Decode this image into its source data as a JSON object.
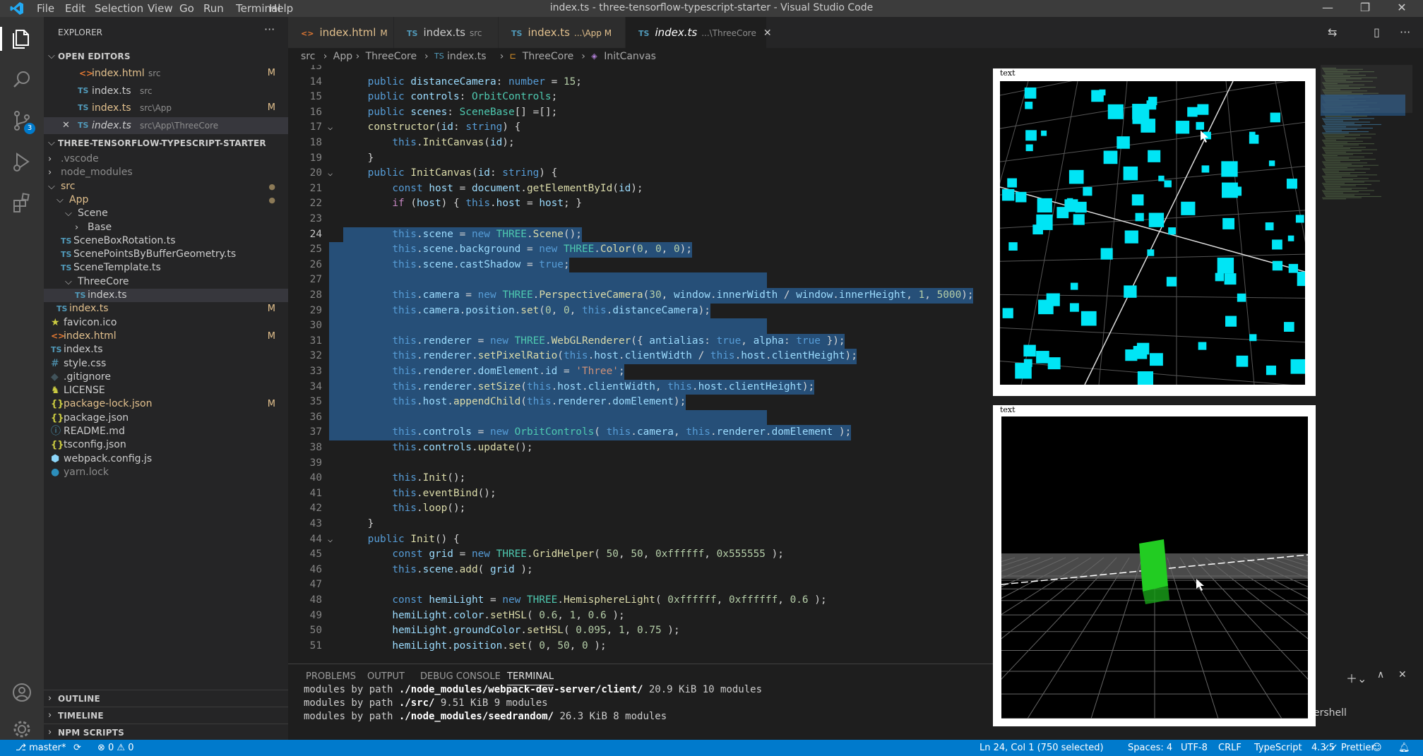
{
  "titlebar": {
    "menu": [
      "File",
      "Edit",
      "Selection",
      "View",
      "Go",
      "Run",
      "Terminal",
      "Help"
    ],
    "title": "index.ts - three-tensorflow-typescript-starter - Visual Studio Code"
  },
  "activity": {
    "scm_badge": "3"
  },
  "sidebar": {
    "header": "EXPLORER",
    "open_editors_title": "OPEN EDITORS",
    "open_editors": [
      {
        "name": "index.html",
        "path": "src",
        "status": "M",
        "icon": "html-icon"
      },
      {
        "name": "index.ts",
        "path": "src",
        "status": "",
        "icon": "ts-icon"
      },
      {
        "name": "index.ts",
        "path": "src\\App",
        "status": "M",
        "icon": "ts-icon"
      },
      {
        "name": "index.ts",
        "path": "src\\App\\ThreeCore",
        "status": "",
        "icon": "ts-icon"
      }
    ],
    "project_title": "THREE-TENSORFLOW-TYPESCRIPT-STARTER",
    "tree": [
      {
        "name": ".vscode",
        "status": ""
      },
      {
        "name": "node_modules",
        "status": ""
      },
      {
        "name": "src",
        "status": "●"
      },
      {
        "name": "App",
        "status": "●"
      },
      {
        "name": "Scene",
        "status": ""
      },
      {
        "name": "Base",
        "status": ""
      },
      {
        "name": "SceneBoxRotation.ts",
        "status": ""
      },
      {
        "name": "ScenePointsByBufferGeometry.ts",
        "status": ""
      },
      {
        "name": "SceneTemplate.ts",
        "status": ""
      },
      {
        "name": "ThreeCore",
        "status": ""
      },
      {
        "name": "index.ts",
        "status": ""
      },
      {
        "name": "index.ts",
        "status": "M"
      },
      {
        "name": "favicon.ico",
        "status": ""
      },
      {
        "name": "index.html",
        "status": "M"
      },
      {
        "name": "index.ts",
        "status": ""
      },
      {
        "name": "style.css",
        "status": ""
      },
      {
        "name": ".gitignore",
        "status": ""
      },
      {
        "name": "LICENSE",
        "status": ""
      },
      {
        "name": "package-lock.json",
        "status": "M"
      },
      {
        "name": "package.json",
        "status": ""
      },
      {
        "name": "README.md",
        "status": ""
      },
      {
        "name": "tsconfig.json",
        "status": ""
      },
      {
        "name": "webpack.config.js",
        "status": ""
      },
      {
        "name": "yarn.lock",
        "status": ""
      }
    ],
    "outline": "OUTLINE",
    "timeline": "TIMELINE",
    "npm": "NPM SCRIPTS"
  },
  "tabs": [
    {
      "name": "index.html",
      "sub": "M",
      "icon": "<>"
    },
    {
      "name": "index.ts",
      "sub": "src",
      "icon": "TS"
    },
    {
      "name": "index.ts",
      "sub": "...\\App  M",
      "icon": "TS"
    },
    {
      "name": "index.ts",
      "sub": "...\\ThreeCore",
      "icon": "TS"
    }
  ],
  "breadcrumbs": [
    "src",
    "App",
    "ThreeCore",
    "index.ts",
    "ThreeCore",
    "InitCanvas"
  ],
  "code_lines": [
    {
      "n": "13",
      "t": ""
    },
    {
      "n": "14",
      "t": "    public distanceCamera: number = 15;"
    },
    {
      "n": "15",
      "t": "    public controls: OrbitControls;"
    },
    {
      "n": "16",
      "t": "    public scenes: SceneBase[] =[];"
    },
    {
      "n": "17",
      "t": "    constructor(id: string) {"
    },
    {
      "n": "18",
      "t": "        this.InitCanvas(id);"
    },
    {
      "n": "19",
      "t": "    }"
    },
    {
      "n": "20",
      "t": "    public InitCanvas(id: string) {"
    },
    {
      "n": "21",
      "t": "        const host = document.getElementById(id);"
    },
    {
      "n": "22",
      "t": "        if (host) { this.host = host; }"
    },
    {
      "n": "23",
      "t": ""
    },
    {
      "n": "24",
      "t": "        this.scene = new THREE.Scene();"
    },
    {
      "n": "25",
      "t": "        this.scene.background = new THREE.Color(0, 0, 0);"
    },
    {
      "n": "26",
      "t": "        this.scene.castShadow = true;"
    },
    {
      "n": "27",
      "t": ""
    },
    {
      "n": "28",
      "t": "        this.camera = new THREE.PerspectiveCamera(30, window.innerWidth / window.innerHeight, 1, 5000);"
    },
    {
      "n": "29",
      "t": "        this.camera.position.set(0, 0, this.distanceCamera);"
    },
    {
      "n": "30",
      "t": ""
    },
    {
      "n": "31",
      "t": "        this.renderer = new THREE.WebGLRenderer({ antialias: true, alpha: true });"
    },
    {
      "n": "32",
      "t": "        this.renderer.setPixelRatio(this.host.clientWidth / this.host.clientHeight);"
    },
    {
      "n": "33",
      "t": "        this.renderer.domElement.id = 'Three';"
    },
    {
      "n": "34",
      "t": "        this.renderer.setSize(this.host.clientWidth, this.host.clientHeight);"
    },
    {
      "n": "35",
      "t": "        this.host.appendChild(this.renderer.domElement);"
    },
    {
      "n": "36",
      "t": ""
    },
    {
      "n": "37",
      "t": "        this.controls = new OrbitControls( this.camera, this.renderer.domElement );"
    },
    {
      "n": "38",
      "t": "        this.controls.update();"
    },
    {
      "n": "39",
      "t": ""
    },
    {
      "n": "40",
      "t": "        this.Init();"
    },
    {
      "n": "41",
      "t": "        this.eventBind();"
    },
    {
      "n": "42",
      "t": "        this.loop();"
    },
    {
      "n": "43",
      "t": "    }"
    },
    {
      "n": "44",
      "t": "    public Init() {"
    },
    {
      "n": "45",
      "t": "        const grid = new THREE.GridHelper( 50, 50, 0xffffff, 0x555555 );"
    },
    {
      "n": "46",
      "t": "        this.scene.add( grid );"
    },
    {
      "n": "47",
      "t": ""
    },
    {
      "n": "48",
      "t": "        const hemiLight = new THREE.HemisphereLight( 0xffffff, 0xffffff, 0.6 );"
    },
    {
      "n": "49",
      "t": "        hemiLight.color.setHSL( 0.6, 1, 0.6 );"
    },
    {
      "n": "50",
      "t": "        hemiLight.groundColor.setHSL( 0.095, 1, 0.75 );"
    },
    {
      "n": "51",
      "t": "        hemiLight.position.set( 0, 50, 0 );"
    }
  ],
  "panel": {
    "tabs": [
      "PROBLEMS",
      "OUTPUT",
      "DEBUG CONSOLE",
      "TERMINAL"
    ],
    "terminal": [
      {
        "a": "modules by path ",
        "b": "./node_modules/webpack-dev-server/client/",
        "c": " 20.9 KiB 10 modules"
      },
      {
        "a": "modules by path ",
        "b": "./src/",
        "c": " 9.51 KiB 9 modules"
      },
      {
        "a": "modules by path ",
        "b": "./node_modules/seedrandom/",
        "c": " 26.3 KiB 8 modules"
      }
    ],
    "shell_partial": "ershell"
  },
  "preview": {
    "caption1": "text",
    "caption2": "text"
  },
  "status": {
    "branch": "master*",
    "problems": "⊗ 0 ⚠ 0",
    "position": "Ln 24, Col 1 (750 selected)",
    "spaces": "Spaces: 4",
    "encoding": "UTF-8",
    "eol": "CRLF",
    "language": "TypeScript",
    "version": "4.3.5",
    "prettier": "✓✓ Prettier"
  },
  "colors": {
    "accent": "#007acc",
    "cube": "#00e5f5",
    "green_box": "#22cc22"
  }
}
